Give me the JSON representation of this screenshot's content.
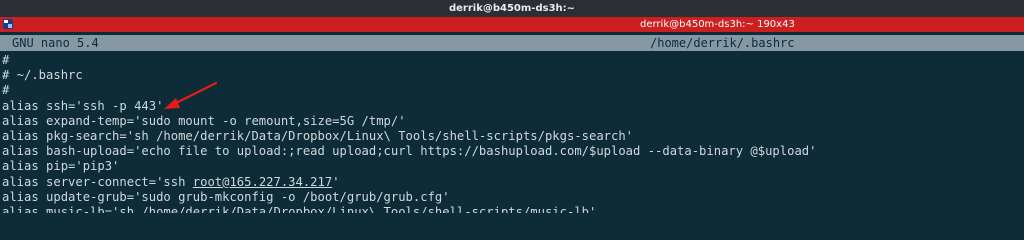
{
  "window": {
    "title": "derrik@b450m-ds3h:~"
  },
  "tab": {
    "title": "derrik@b450m-ds3h:~ 190x43"
  },
  "nano": {
    "version": "GNU nano 5.4",
    "filename": "/home/derrik/.bashrc"
  },
  "colors": {
    "background": "#0d2c38",
    "titlebar": "#2b2f33",
    "tab_bar": "#cc1f1f",
    "nano_header": "#8598a3",
    "text": "#cfd8dc",
    "annotation_arrow": "#e21b1b"
  },
  "annotation": {
    "icon": "red-arrow-icon"
  },
  "editor": {
    "lines": [
      "#",
      "# ~/.bashrc",
      "#",
      "alias ssh='ssh -p 443'",
      "alias expand-temp='sudo mount -o remount,size=5G /tmp/'",
      "alias pkg-search='sh /home/derrik/Data/Dropbox/Linux\\ Tools/shell-scripts/pkgs-search'",
      "alias bash-upload='echo file to upload:;read upload;curl https://bashupload.com/$upload --data-binary @$upload'",
      "alias pip='pip3'",
      "alias update-grub='sudo grub-mkconfig -o /boot/grub/grub.cfg'"
    ],
    "server_connect": {
      "prefix": "alias server-connect='ssh ",
      "host": "root@165.227.34.217",
      "suffix": "'"
    },
    "partial_line": "alias music-lb='sh /home/derrik/Data/Dropbox/Linux\\ Tools/shell-scripts/music-lb'"
  }
}
